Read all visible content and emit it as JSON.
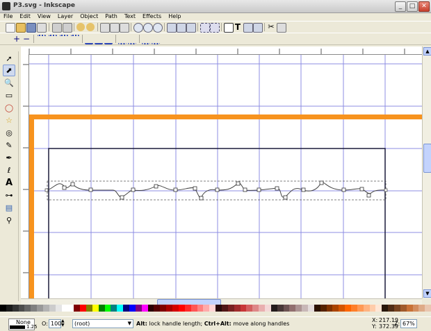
{
  "window": {
    "title": "P3.svg - Inkscape",
    "minimize": "_",
    "maximize": "□",
    "close": "✕"
  },
  "menu": [
    "File",
    "Edit",
    "View",
    "Layer",
    "Object",
    "Path",
    "Text",
    "Effects",
    "Help"
  ],
  "toolbox": [
    {
      "name": "selector-tool",
      "glyph": "➚"
    },
    {
      "name": "node-tool",
      "glyph": "⬈",
      "active": true
    },
    {
      "name": "zoom-tool",
      "glyph": "🔍"
    },
    {
      "name": "rectangle-tool",
      "glyph": "▭"
    },
    {
      "name": "ellipse-tool",
      "glyph": "◯"
    },
    {
      "name": "star-tool",
      "glyph": "☆"
    },
    {
      "name": "spiral-tool",
      "glyph": "◎"
    },
    {
      "name": "pencil-tool",
      "glyph": "✎"
    },
    {
      "name": "pen-tool",
      "glyph": "✒"
    },
    {
      "name": "calligraphy-tool",
      "glyph": "ℓ"
    },
    {
      "name": "text-tool",
      "glyph": "A"
    },
    {
      "name": "connector-tool",
      "glyph": "⊶"
    },
    {
      "name": "gradient-tool",
      "glyph": "▤"
    },
    {
      "name": "dropper-tool",
      "glyph": "⚲"
    }
  ],
  "status": {
    "fill_label": "None",
    "stroke_width": "1.25",
    "opacity_label": "O:",
    "opacity_value": "100",
    "layer": "(root)",
    "message_bold1": "Alt:",
    "message_text1": " lock handle length; ",
    "message_bold2": "Ctrl+Alt:",
    "message_text2": " move along handles",
    "x_label": "X:",
    "x_value": "217.19",
    "y_label": "Y:",
    "y_value": "372.39",
    "zoom_label": "Z:",
    "zoom_value": "67%"
  },
  "colors": {
    "accent": "#f7931e",
    "guide": "#6b6bdc",
    "frame": "#1a1a3a"
  },
  "palette": [
    "#000000",
    "#1a1a1a",
    "#333333",
    "#4d4d4d",
    "#666666",
    "#808080",
    "#999999",
    "#b3b3b3",
    "#cccccc",
    "#e6e6e6",
    "#ffffff",
    "#ffffff",
    "#800000",
    "#ff0000",
    "#808000",
    "#ffff00",
    "#008000",
    "#00ff00",
    "#008080",
    "#00ffff",
    "#000080",
    "#0000ff",
    "#800080",
    "#ff00ff",
    "#2b0000",
    "#550000",
    "#800000",
    "#aa0000",
    "#d40000",
    "#ff0000",
    "#ff2a2a",
    "#ff5555",
    "#ff8080",
    "#ffaaaa",
    "#ffd5d5",
    "#280b0b",
    "#501616",
    "#782121",
    "#a02c2c",
    "#c83737",
    "#d35f5f",
    "#de8787",
    "#e9afaf",
    "#f4d7d7",
    "#241c1c",
    "#483737",
    "#6c5353",
    "#916f6f",
    "#ac9393",
    "#c8b7b7",
    "#e3dbdb",
    "#2b1100",
    "#552200",
    "#803300",
    "#aa4400",
    "#d45500",
    "#ff6600",
    "#ff7f2a",
    "#ff9955",
    "#ffb380",
    "#ffccaa",
    "#ffe6d5",
    "#28170b",
    "#502d16",
    "#784421",
    "#a05a2c",
    "#c87137",
    "#d38d5f",
    "#deaa87",
    "#e9c6af"
  ]
}
